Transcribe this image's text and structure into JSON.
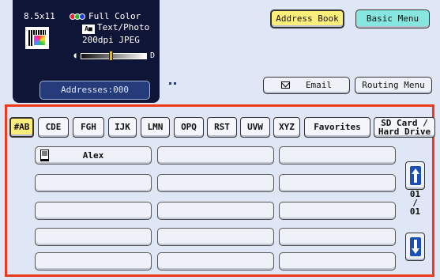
{
  "status": {
    "paper_size": "8.5x11",
    "color_mode": "Full Color",
    "original_type": "Text/Photo",
    "resolution_format": "200dpi JPEG",
    "density_level": 0.45,
    "addresses_label": "Addresses:000",
    "icons": [
      "color-dots-icon",
      "text-photo-icon",
      "document-preview-icon",
      "density-slider"
    ]
  },
  "top_buttons": {
    "address_book": "Address Book",
    "basic_menu": "Basic Menu",
    "email": "Email",
    "routing_menu": "Routing Menu"
  },
  "tabs": [
    {
      "label": "#AB",
      "active": true
    },
    {
      "label": "CDE"
    },
    {
      "label": "FGH"
    },
    {
      "label": "IJK"
    },
    {
      "label": "LMN"
    },
    {
      "label": "OPQ"
    },
    {
      "label": "RST"
    },
    {
      "label": "UVW"
    },
    {
      "label": "XYZ"
    },
    {
      "label": "Favorites"
    },
    {
      "label_line1": "SD Card /",
      "label_line2": "Hard Drive"
    }
  ],
  "address_entries": [
    {
      "name": "Alex",
      "icon": "phone-icon"
    },
    {
      "name": ""
    },
    {
      "name": ""
    },
    {
      "name": ""
    },
    {
      "name": ""
    },
    {
      "name": ""
    },
    {
      "name": ""
    },
    {
      "name": ""
    },
    {
      "name": ""
    },
    {
      "name": ""
    },
    {
      "name": ""
    },
    {
      "name": ""
    },
    {
      "name": ""
    },
    {
      "name": ""
    },
    {
      "name": ""
    }
  ],
  "pager": {
    "current": "01",
    "separator": "/",
    "total": "01"
  },
  "colors": {
    "status_bg": "#0e1536",
    "highlight_frame": "#ee3a1c",
    "active_tab": "#ffef7a",
    "basic_menu": "#88e6e0",
    "arrow_blue": "#1c4fb6"
  }
}
